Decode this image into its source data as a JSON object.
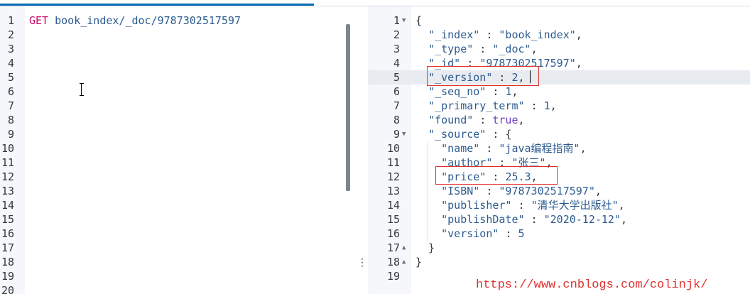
{
  "request_editor": {
    "method": "GET",
    "url": "book_index/_doc/9787302517597",
    "line_numbers": [
      "1",
      "2",
      "3",
      "4",
      "5",
      "6",
      "7",
      "8",
      "9",
      "10",
      "11",
      "12",
      "13",
      "14",
      "15",
      "16",
      "17",
      "18",
      "19",
      "20"
    ]
  },
  "response_viewer": {
    "line_numbers": [
      "1",
      "2",
      "3",
      "4",
      "5",
      "6",
      "7",
      "8",
      "9",
      "10",
      "11",
      "12",
      "13",
      "14",
      "15",
      "16",
      "17",
      "18",
      "19"
    ],
    "highlighted_line": "5",
    "fields": {
      "_index_key": "\"_index\"",
      "_index_val": "\"book_index\"",
      "_type_key": "\"_type\"",
      "_type_val": "\"_doc\"",
      "_id_key": "\"_id\"",
      "_id_val": "\"9787302517597\"",
      "_version_key": "\"_version\"",
      "_version_val": "2",
      "_seq_no_key": "\"_seq_no\"",
      "_seq_no_val": "1",
      "_primary_term_key": "\"_primary_term\"",
      "_primary_term_val": "1",
      "found_key": "\"found\"",
      "found_val": "true",
      "_source_key": "\"_source\"",
      "name_key": "\"name\"",
      "name_val": "\"java编程指南\"",
      "author_key": "\"author\"",
      "author_val": "\"张三\"",
      "price_key": "\"price\"",
      "price_val": "25.3",
      "isbn_key": "\"ISBN\"",
      "isbn_val": "\"9787302517597\"",
      "publisher_key": "\"publisher\"",
      "publisher_val": "\"清华大学出版社\"",
      "publishDate_key": "\"publishDate\"",
      "publishDate_val": "\"2020-12-12\"",
      "version_key": "\"version\"",
      "version_val": "5"
    }
  },
  "resizer_glyph": "⋮",
  "watermark": "https://www.cnblogs.com/colinjk/",
  "colors": {
    "method": "#c80a68",
    "json_string": "#2d5b8f",
    "boolean": "#6f42c1",
    "annotation": "#e0302d",
    "tab_accent": "#006bb4"
  }
}
